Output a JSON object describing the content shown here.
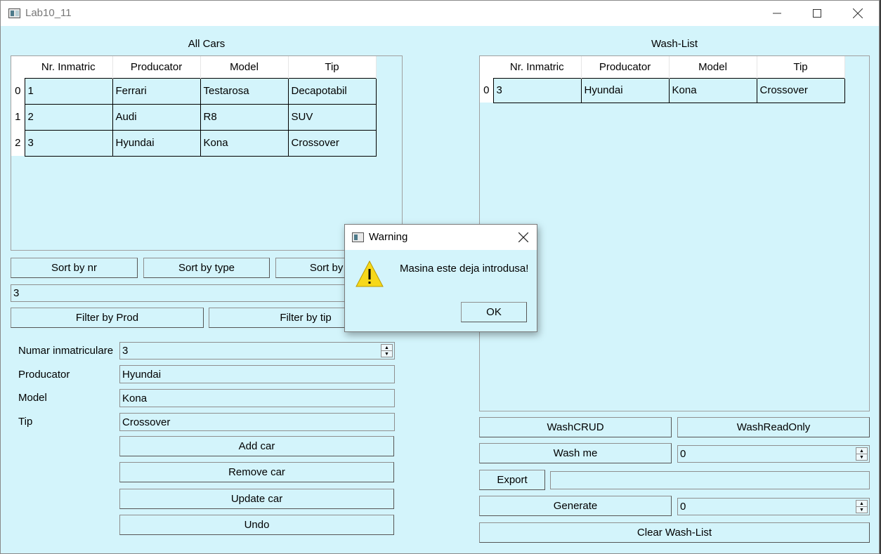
{
  "window": {
    "title": "Lab10_11",
    "minimize_icon": "minimize-icon",
    "maximize_icon": "maximize-icon",
    "close_icon": "close-icon"
  },
  "all_cars": {
    "label": "All Cars",
    "columns": [
      "Nr. Inmatric",
      "Producator",
      "Model",
      "Tip"
    ],
    "rows": [
      {
        "index": "0",
        "cells": [
          "1",
          "Ferrari",
          "Testarosa",
          "Decapotabil"
        ]
      },
      {
        "index": "1",
        "cells": [
          "2",
          "Audi",
          "R8",
          "SUV"
        ]
      },
      {
        "index": "2",
        "cells": [
          "3",
          "Hyundai",
          "Kona",
          "Crossover"
        ]
      }
    ],
    "sort_buttons": {
      "nr": "Sort by nr",
      "type": "Sort by type",
      "prod": "Sort by Prod"
    },
    "filter_value": "3",
    "filter_buttons": {
      "prod": "Filter by Prod",
      "tip": "Filter by tip"
    }
  },
  "form": {
    "nr_label": "Numar inmatriculare",
    "nr_value": "3",
    "producator_label": "Producator",
    "producator_value": "Hyundai",
    "model_label": "Model",
    "model_value": "Kona",
    "tip_label": "Tip",
    "tip_value": "Crossover",
    "buttons": {
      "add": "Add car",
      "remove": "Remove car",
      "update": "Update car",
      "undo": "Undo"
    }
  },
  "wash_list": {
    "label": "Wash-List",
    "columns": [
      "Nr. Inmatric",
      "Producator",
      "Model",
      "Tip"
    ],
    "rows": [
      {
        "index": "0",
        "cells": [
          "3",
          "Hyundai",
          "Kona",
          "Crossover"
        ]
      }
    ],
    "buttons": {
      "crud": "WashCRUD",
      "readonly": "WashReadOnly",
      "wash_me": "Wash me",
      "export": "Export",
      "generate": "Generate",
      "clear": "Clear Wash-List"
    },
    "wash_me_value": "0",
    "export_value": "",
    "generate_value": "0"
  },
  "dialog": {
    "title": "Warning",
    "message": "Masina este deja introdusa!",
    "ok": "OK",
    "icon": "warning-icon"
  },
  "colors": {
    "background": "#d3f4fb",
    "warning_yellow": "#f7d81a"
  }
}
